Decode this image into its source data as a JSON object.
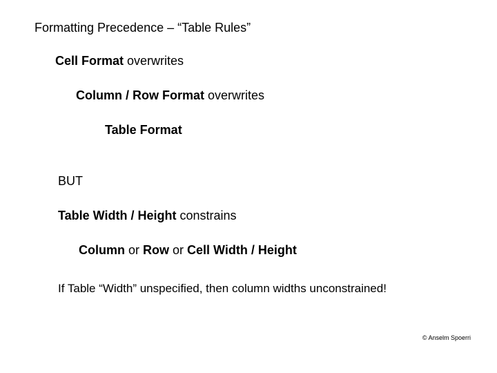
{
  "title": "Formatting Precedence – “Table Rules”",
  "line1": {
    "strong": "Cell Format",
    "rest": " overwrites"
  },
  "line2": {
    "strong": "Column / Row Format",
    "rest": " overwrites"
  },
  "line3": {
    "strong": "Table Format"
  },
  "but": "BUT",
  "line4": {
    "strong": "Table Width / Height",
    "rest": " constrains"
  },
  "line5": {
    "s1": "Column",
    "or1": " or ",
    "s2": "Row",
    "or2": " or ",
    "s3": "Cell Width / Height"
  },
  "note": "If Table “Width” unspecified, then column widths unconstrained!",
  "copyright": "© Anselm Spoerri"
}
